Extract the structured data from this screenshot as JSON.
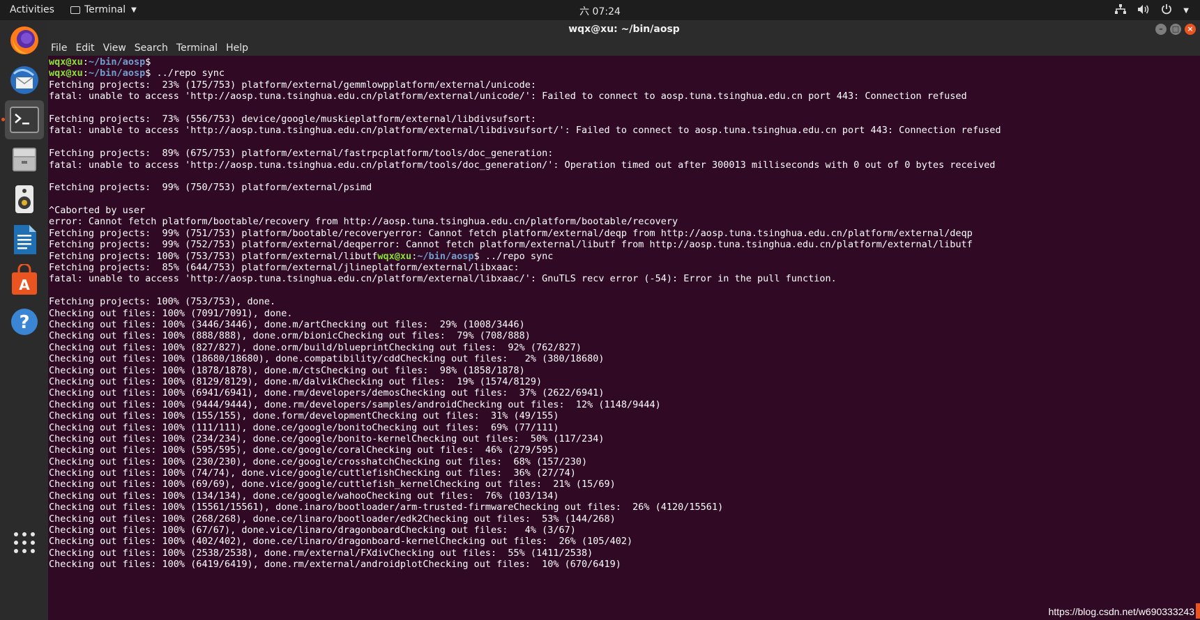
{
  "topbar": {
    "activities": "Activities",
    "app_menu": "Terminal",
    "clock": "六 07:24"
  },
  "window": {
    "title": "wqx@xu: ~/bin/aosp",
    "menu": [
      "File",
      "Edit",
      "View",
      "Search",
      "Terminal",
      "Help"
    ]
  },
  "dock": {
    "items": [
      "firefox",
      "thunderbird",
      "terminal",
      "files",
      "rhythmbox",
      "writer",
      "software",
      "help"
    ]
  },
  "terminal": {
    "prompt_user": "wqx@xu",
    "prompt_path": "~/bin/aosp",
    "lines": [
      {
        "prompt": true,
        "cmd": ""
      },
      {
        "prompt": true,
        "cmd": " ../repo sync"
      },
      {
        "text": "Fetching projects:  23% (175/753) platform/external/gemmlowpplatform/external/unicode:"
      },
      {
        "text": "fatal: unable to access 'http://aosp.tuna.tsinghua.edu.cn/platform/external/unicode/': Failed to connect to aosp.tuna.tsinghua.edu.cn port 443: Connection refused"
      },
      {
        "text": ""
      },
      {
        "text": "Fetching projects:  73% (556/753) device/google/muskieplatform/external/libdivsufsort:"
      },
      {
        "text": "fatal: unable to access 'http://aosp.tuna.tsinghua.edu.cn/platform/external/libdivsufsort/': Failed to connect to aosp.tuna.tsinghua.edu.cn port 443: Connection refused"
      },
      {
        "text": ""
      },
      {
        "text": "Fetching projects:  89% (675/753) platform/external/fastrpcplatform/tools/doc_generation:"
      },
      {
        "text": "fatal: unable to access 'http://aosp.tuna.tsinghua.edu.cn/platform/tools/doc_generation/': Operation timed out after 300013 milliseconds with 0 out of 0 bytes received"
      },
      {
        "text": ""
      },
      {
        "text": "Fetching projects:  99% (750/753) platform/external/psimd"
      },
      {
        "text": ""
      },
      {
        "text": "^Caborted by user"
      },
      {
        "text": "error: Cannot fetch platform/bootable/recovery from http://aosp.tuna.tsinghua.edu.cn/platform/bootable/recovery"
      },
      {
        "text": "Fetching projects:  99% (751/753) platform/bootable/recoveryerror: Cannot fetch platform/external/deqp from http://aosp.tuna.tsinghua.edu.cn/platform/external/deqp"
      },
      {
        "text": "Fetching projects:  99% (752/753) platform/external/deqperror: Cannot fetch platform/external/libutf from http://aosp.tuna.tsinghua.edu.cn/platform/external/libutf"
      },
      {
        "text": "Fetching projects: 100% (753/753) platform/external/libutf",
        "prompt_after": true,
        "cmd": " ../repo sync"
      },
      {
        "text": "Fetching projects:  85% (644/753) platform/external/jlineplatform/external/libxaac:"
      },
      {
        "text": "fatal: unable to access 'http://aosp.tuna.tsinghua.edu.cn/platform/external/libxaac/': GnuTLS recv error (-54): Error in the pull function."
      },
      {
        "text": ""
      },
      {
        "text": "Fetching projects: 100% (753/753), done."
      },
      {
        "text": "Checking out files: 100% (7091/7091), done."
      },
      {
        "text": "Checking out files: 100% (3446/3446), done.m/artChecking out files:  29% (1008/3446)"
      },
      {
        "text": "Checking out files: 100% (888/888), done.orm/bionicChecking out files:  79% (708/888)"
      },
      {
        "text": "Checking out files: 100% (827/827), done.orm/build/blueprintChecking out files:  92% (762/827)"
      },
      {
        "text": "Checking out files: 100% (18680/18680), done.compatibility/cddChecking out files:   2% (380/18680)"
      },
      {
        "text": "Checking out files: 100% (1878/1878), done.m/ctsChecking out files:  98% (1858/1878)"
      },
      {
        "text": "Checking out files: 100% (8129/8129), done.m/dalvikChecking out files:  19% (1574/8129)"
      },
      {
        "text": "Checking out files: 100% (6941/6941), done.rm/developers/demosChecking out files:  37% (2622/6941)"
      },
      {
        "text": "Checking out files: 100% (9444/9444), done.rm/developers/samples/androidChecking out files:  12% (1148/9444)"
      },
      {
        "text": "Checking out files: 100% (155/155), done.form/developmentChecking out files:  31% (49/155)"
      },
      {
        "text": "Checking out files: 100% (111/111), done.ce/google/bonitoChecking out files:  69% (77/111)"
      },
      {
        "text": "Checking out files: 100% (234/234), done.ce/google/bonito-kernelChecking out files:  50% (117/234)"
      },
      {
        "text": "Checking out files: 100% (595/595), done.ce/google/coralChecking out files:  46% (279/595)"
      },
      {
        "text": "Checking out files: 100% (230/230), done.ce/google/crosshatchChecking out files:  68% (157/230)"
      },
      {
        "text": "Checking out files: 100% (74/74), done.vice/google/cuttlefishChecking out files:  36% (27/74)"
      },
      {
        "text": "Checking out files: 100% (69/69), done.vice/google/cuttlefish_kernelChecking out files:  21% (15/69)"
      },
      {
        "text": "Checking out files: 100% (134/134), done.ce/google/wahooChecking out files:  76% (103/134)"
      },
      {
        "text": "Checking out files: 100% (15561/15561), done.inaro/bootloader/arm-trusted-firmwareChecking out files:  26% (4120/15561)"
      },
      {
        "text": "Checking out files: 100% (268/268), done.ce/linaro/bootloader/edk2Checking out files:  53% (144/268)"
      },
      {
        "text": "Checking out files: 100% (67/67), done.vice/linaro/dragonboardChecking out files:   4% (3/67)"
      },
      {
        "text": "Checking out files: 100% (402/402), done.ce/linaro/dragonboard-kernelChecking out files:  26% (105/402)"
      },
      {
        "text": "Checking out files: 100% (2538/2538), done.rm/external/FXdivChecking out files:  55% (1411/2538)"
      },
      {
        "text": "Checking out files: 100% (6419/6419), done.rm/external/androidplotChecking out files:  10% (670/6419)"
      }
    ]
  },
  "watermark": "https://blog.csdn.net/w690333243",
  "colors": {
    "terminal_bg": "#300a24",
    "prompt_user": "#8ae234",
    "prompt_path": "#729fcf",
    "accent": "#e95420"
  }
}
